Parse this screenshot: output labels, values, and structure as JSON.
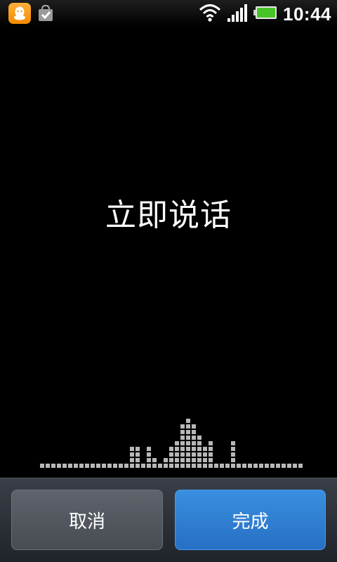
{
  "status_bar": {
    "time": "10:44",
    "icons": [
      "qq-notification-icon",
      "market-bag-icon",
      "wifi-icon",
      "signal-icon",
      "battery-icon"
    ],
    "accent_colors": {
      "qq": "#f8a21a",
      "battery": "#4ccb2a"
    }
  },
  "prompt": {
    "text": "立即说话"
  },
  "level_meter": {
    "columns": [
      1,
      1,
      1,
      1,
      1,
      1,
      1,
      1,
      1,
      1,
      1,
      1,
      1,
      1,
      1,
      1,
      4,
      4,
      1,
      4,
      2,
      1,
      2,
      4,
      5,
      8,
      9,
      8,
      6,
      4,
      5,
      1,
      1,
      1,
      5,
      1,
      1,
      1,
      1,
      1,
      1,
      1,
      1,
      1,
      1,
      1,
      1,
      1
    ],
    "color": "#b8b8b8"
  },
  "buttons": {
    "cancel_label": "取消",
    "done_label": "完成",
    "done_color": "#2f7fd6"
  }
}
